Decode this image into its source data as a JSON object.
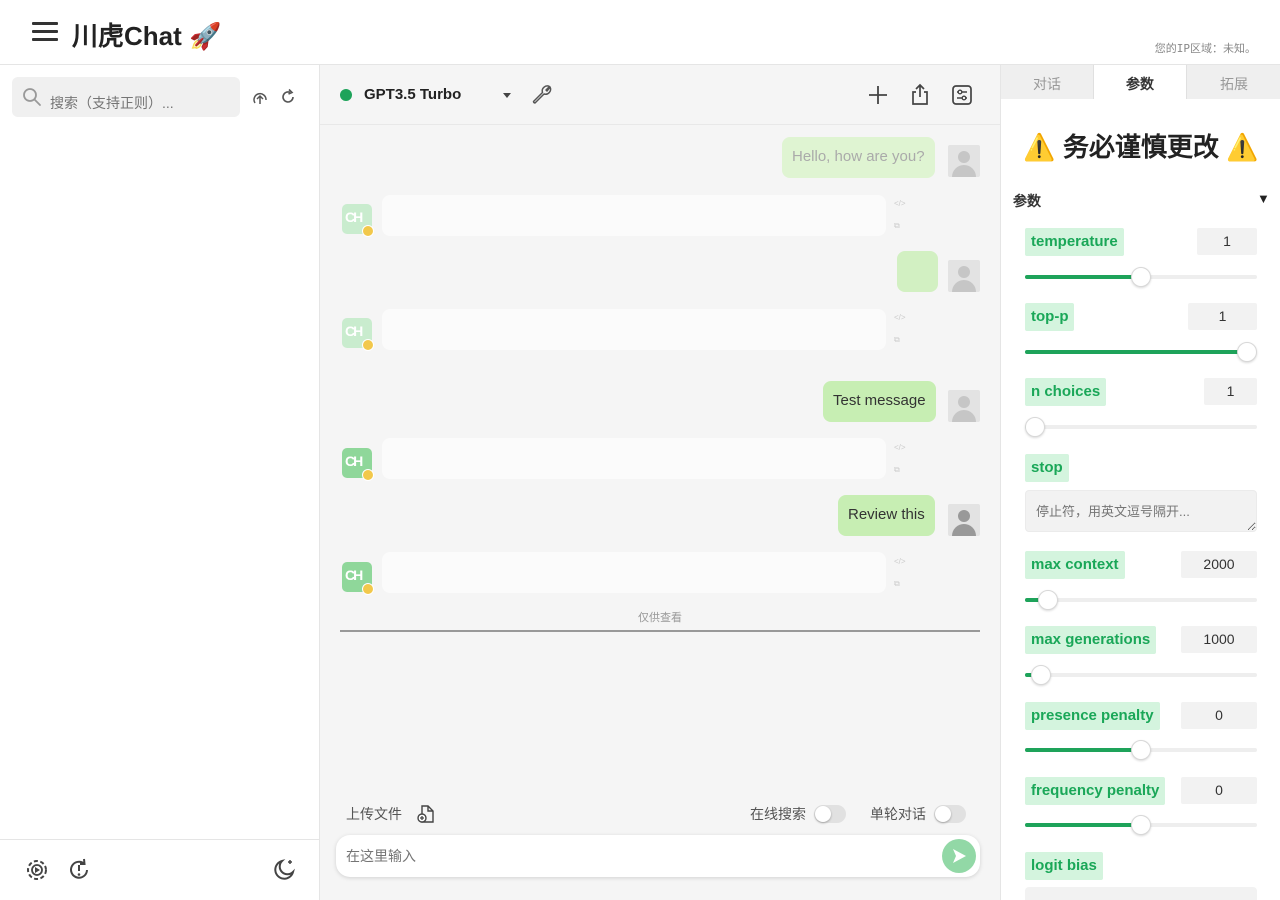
{
  "app": {
    "title": "川虎Chat 🚀",
    "ip_info": "您的IP区域：未知。"
  },
  "sidebar": {
    "search_placeholder": "搜索（支持正则）..."
  },
  "header": {
    "model": "GPT3.5 Turbo"
  },
  "messages": [
    {
      "role": "user",
      "text": "Hello, how are you?"
    },
    {
      "role": "bot",
      "text": ""
    },
    {
      "role": "user",
      "text": ""
    },
    {
      "role": "bot",
      "text": ""
    },
    {
      "role": "user",
      "text": "Test message"
    },
    {
      "role": "bot",
      "text": ""
    },
    {
      "role": "user",
      "text": "Review this"
    },
    {
      "role": "bot",
      "text": ""
    }
  ],
  "readonly_note": "仅供查看",
  "composer": {
    "upload_label": "上传文件",
    "web_search_label": "在线搜索",
    "single_turn_label": "单轮对话",
    "input_placeholder": "在这里输入"
  },
  "right_panel": {
    "tabs": [
      "对话",
      "参数",
      "拓展"
    ],
    "active_tab": "参数",
    "warning_title": "⚠️ 务必谨慎更改 ⚠️",
    "section_title": "参数",
    "section_caret": "▼",
    "params": {
      "temperature": {
        "label": "temperature",
        "value": "1",
        "level": 0.5
      },
      "top_p": {
        "label": "top-p",
        "value": "1",
        "level": 1.0
      },
      "n_choices": {
        "label": "n choices",
        "value": "1",
        "level": 0.0
      },
      "stop": {
        "label": "stop",
        "placeholder": "停止符，用英文逗号隔开..."
      },
      "max_context": {
        "label": "max context",
        "value": "2000",
        "level": 0.06
      },
      "max_generations": {
        "label": "max generations",
        "value": "1000",
        "level": 0.03
      },
      "presence_penalty": {
        "label": "presence penalty",
        "value": "0",
        "level": 0.5
      },
      "frequency_penalty": {
        "label": "frequency penalty",
        "value": "0",
        "level": 0.5
      },
      "logit_bias": {
        "label": "logit bias"
      }
    }
  },
  "colors": {
    "accent": "#1ea35a",
    "user_bubble": "#c7eeb3",
    "param_label_bg": "#d4f4de"
  }
}
